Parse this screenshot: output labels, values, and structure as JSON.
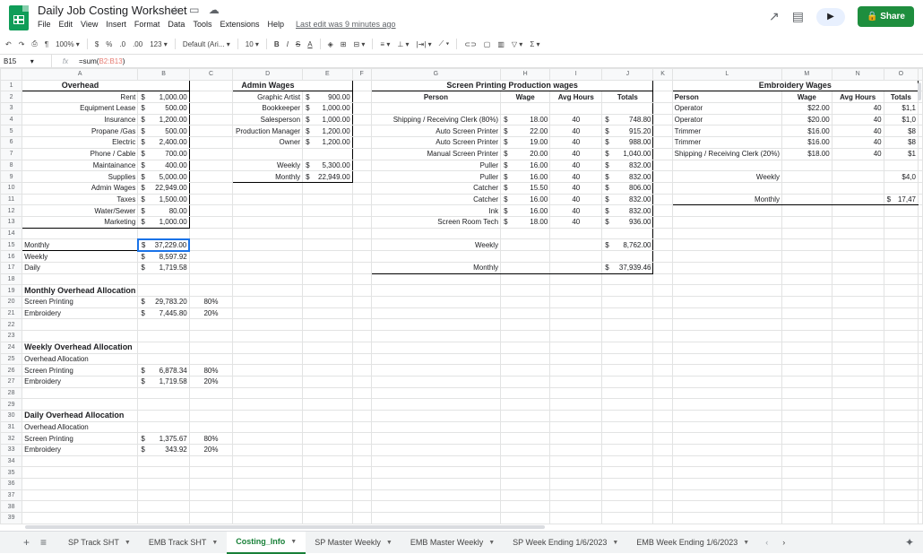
{
  "app": {
    "title": "Daily Job Costing Worksheet",
    "menu": [
      "File",
      "Edit",
      "View",
      "Insert",
      "Format",
      "Data",
      "Tools",
      "Extensions",
      "Help"
    ],
    "last_edit": "Last edit was 9 minutes ago",
    "share_label": "Share",
    "accent": "#1e8e3e"
  },
  "toolbar": {
    "zoom": "100%",
    "currency": "$",
    "percent": "%",
    "dec_less": ".0",
    "dec_more": ".00",
    "more_formats": "123",
    "font": "Default (Ari...",
    "font_size": "10",
    "bold": "B",
    "italic": "I",
    "strike": "S",
    "text_color": "A"
  },
  "formula_bar": {
    "cell": "B15",
    "fx": "fx",
    "formula_prefix": "=sum(",
    "formula_ref": "B2:B13",
    "formula_suffix": ")"
  },
  "columns": [
    "A",
    "B",
    "C",
    "D",
    "E",
    "F",
    "G",
    "H",
    "I",
    "J",
    "K",
    "L",
    "M",
    "N",
    "O"
  ],
  "rows": [
    "1",
    "2",
    "3",
    "4",
    "5",
    "6",
    "7",
    "8",
    "9",
    "10",
    "11",
    "12",
    "13",
    "14",
    "15",
    "16",
    "17",
    "18",
    "19",
    "20",
    "21",
    "22",
    "23",
    "24",
    "25",
    "26",
    "27",
    "28",
    "29",
    "30",
    "31",
    "32",
    "33",
    "34",
    "35",
    "36",
    "37",
    "38",
    "39"
  ],
  "overhead": {
    "title": "Overhead",
    "items": [
      {
        "label": "Rent",
        "cur": "$",
        "value": "1,000.00"
      },
      {
        "label": "Equipment Lease",
        "cur": "$",
        "value": "500.00"
      },
      {
        "label": "Insurance",
        "cur": "$",
        "value": "1,200.00"
      },
      {
        "label": "Propane /Gas",
        "cur": "$",
        "value": "500.00"
      },
      {
        "label": "Electric",
        "cur": "$",
        "value": "2,400.00"
      },
      {
        "label": "Phone / Cable",
        "cur": "$",
        "value": "700.00"
      },
      {
        "label": "Maintainance",
        "cur": "$",
        "value": "400.00"
      },
      {
        "label": "Supplies",
        "cur": "$",
        "value": "5,000.00"
      },
      {
        "label": "Admin Wages",
        "cur": "$",
        "value": "22,949.00"
      },
      {
        "label": "Taxes",
        "cur": "$",
        "value": "1,500.00"
      },
      {
        "label": "Water/Sewer",
        "cur": "$",
        "value": "80.00"
      },
      {
        "label": "Marketing",
        "cur": "$",
        "value": "1,000.00"
      }
    ],
    "totals": [
      {
        "label": "Monthly",
        "cur": "$",
        "value": "37,229.00"
      },
      {
        "label": "Weekly",
        "cur": "$",
        "value": "8,597.92"
      },
      {
        "label": "Daily",
        "cur": "$",
        "value": "1,719.58"
      }
    ]
  },
  "monthly_alloc": {
    "title": "Monthly Overhead Allocation",
    "rows": [
      {
        "label": "Screen Printing",
        "cur": "$",
        "value": "29,783.20",
        "pct": "80%"
      },
      {
        "label": "Embroidery",
        "cur": "$",
        "value": "7,445.80",
        "pct": "20%"
      }
    ]
  },
  "weekly_alloc": {
    "title": "Weekly Overhead Allocation",
    "sub": "Overhead Allocation",
    "rows": [
      {
        "label": "Screen Printing",
        "cur": "$",
        "value": "6,878.34",
        "pct": "80%"
      },
      {
        "label": "Embroidery",
        "cur": "$",
        "value": "1,719.58",
        "pct": "20%"
      }
    ]
  },
  "daily_alloc": {
    "title": "Daily Overhead Allocation",
    "sub": "Overhead Allocation",
    "rows": [
      {
        "label": "Screen Printing",
        "cur": "$",
        "value": "1,375.67",
        "pct": "80%"
      },
      {
        "label": "Embroidery",
        "cur": "$",
        "value": "343.92",
        "pct": "20%"
      }
    ]
  },
  "admin": {
    "title": "Admin Wages",
    "items": [
      {
        "label": "Graphic Artist",
        "cur": "$",
        "value": "900.00"
      },
      {
        "label": "Bookkeeper",
        "cur": "$",
        "value": "1,000.00"
      },
      {
        "label": "Salesperson",
        "cur": "$",
        "value": "1,000.00"
      },
      {
        "label": "Production Manager",
        "cur": "$",
        "value": "1,200.00"
      },
      {
        "label": "Owner",
        "cur": "$",
        "value": "1,200.00"
      }
    ],
    "weekly": {
      "label": "Weekly",
      "cur": "$",
      "value": "5,300.00"
    },
    "monthly": {
      "label": "Monthly",
      "cur": "$",
      "value": "22,949.00"
    }
  },
  "sp_wages": {
    "title": "Screen Printing Production wages",
    "headers": [
      "Person",
      "Wage",
      "Avg Hours",
      "Totals"
    ],
    "rows": [
      {
        "person": "Shipping / Receiving Clerk (80%)",
        "cur": "$",
        "wage": "18.00",
        "hours": "40",
        "tcur": "$",
        "total": "748.80"
      },
      {
        "person": "Auto Screen Printer",
        "cur": "$",
        "wage": "22.00",
        "hours": "40",
        "tcur": "$",
        "total": "915.20"
      },
      {
        "person": "Auto Screen Printer",
        "cur": "$",
        "wage": "19.00",
        "hours": "40",
        "tcur": "$",
        "total": "988.00"
      },
      {
        "person": "Manual Screen Printer",
        "cur": "$",
        "wage": "20.00",
        "hours": "40",
        "tcur": "$",
        "total": "1,040.00"
      },
      {
        "person": "Puller",
        "cur": "$",
        "wage": "16.00",
        "hours": "40",
        "tcur": "$",
        "total": "832.00"
      },
      {
        "person": "Puller",
        "cur": "$",
        "wage": "16.00",
        "hours": "40",
        "tcur": "$",
        "total": "832.00"
      },
      {
        "person": "Catcher",
        "cur": "$",
        "wage": "15.50",
        "hours": "40",
        "tcur": "$",
        "total": "806.00"
      },
      {
        "person": "Catcher",
        "cur": "$",
        "wage": "16.00",
        "hours": "40",
        "tcur": "$",
        "total": "832.00"
      },
      {
        "person": "Ink",
        "cur": "$",
        "wage": "16.00",
        "hours": "40",
        "tcur": "$",
        "total": "832.00"
      },
      {
        "person": "Screen Room Tech",
        "cur": "$",
        "wage": "18.00",
        "hours": "40",
        "tcur": "$",
        "total": "936.00"
      }
    ],
    "weekly": {
      "label": "Weekly",
      "cur": "$",
      "value": "8,762.00"
    },
    "monthly": {
      "label": "Monthly",
      "cur": "$",
      "value": "37,939.46"
    }
  },
  "emb_wages": {
    "title": "Embroidery Wages",
    "headers": [
      "Person",
      "Wage",
      "Avg Hours",
      "Totals"
    ],
    "rows": [
      {
        "person": "Operator",
        "wage": "$22.00",
        "hours": "40",
        "total": "$1,1"
      },
      {
        "person": "Operator",
        "wage": "$20.00",
        "hours": "40",
        "total": "$1,0"
      },
      {
        "person": "Trimmer",
        "wage": "$16.00",
        "hours": "40",
        "total": "$8"
      },
      {
        "person": "Trimmer",
        "wage": "$16.00",
        "hours": "40",
        "total": "$8"
      },
      {
        "person": "Shipping / Receiving Clerk (20%)",
        "wage": "$18.00",
        "hours": "40",
        "total": "$1"
      }
    ],
    "weekly": {
      "label": "Weekly",
      "value": "$4,0"
    },
    "monthly": {
      "label": "Monthly",
      "cur": "$",
      "value": "17,47"
    }
  },
  "tabs": [
    {
      "label": "SP Track SHT",
      "active": false
    },
    {
      "label": "EMB Track SHT",
      "active": false
    },
    {
      "label": "Costing_Info",
      "active": true
    },
    {
      "label": "SP Master Weekly",
      "active": false
    },
    {
      "label": "EMB Master Weekly",
      "active": false
    },
    {
      "label": "SP Week Ending 1/6/2023",
      "active": false
    },
    {
      "label": "EMB Week Ending 1/6/2023",
      "active": false
    }
  ]
}
